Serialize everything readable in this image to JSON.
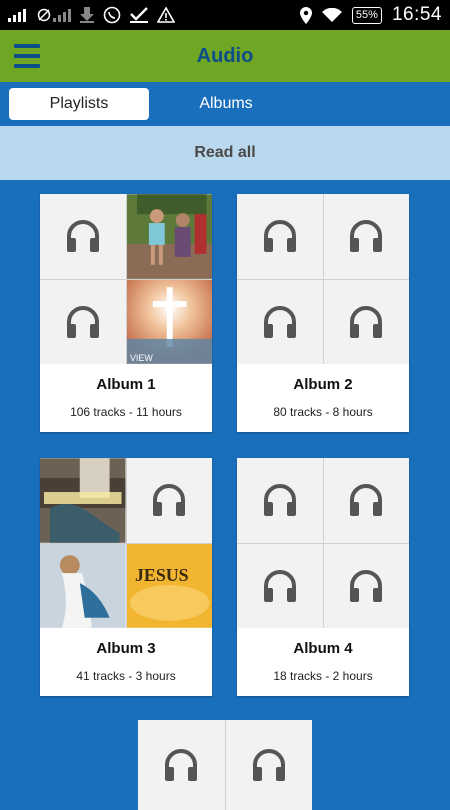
{
  "status_bar": {
    "time": "16:54",
    "battery": "55%"
  },
  "app_bar": {
    "title": "Audio"
  },
  "tabs": [
    {
      "label": "Playlists",
      "active": true
    },
    {
      "label": "Albums",
      "active": false
    }
  ],
  "read_all": "Read all",
  "albums": [
    {
      "title": "Album 1",
      "subtitle": "106 tracks - 11 hours",
      "tiles": [
        "headphones-icon",
        "photo-children",
        "headphones-icon",
        "photo-light-cross"
      ]
    },
    {
      "title": "Album 2",
      "subtitle": "80 tracks - 8 hours",
      "tiles": [
        "headphones-icon",
        "headphones-icon",
        "headphones-icon",
        "headphones-icon"
      ]
    },
    {
      "title": "Album 3",
      "subtitle": "41 tracks - 3 hours",
      "tiles": [
        "photo-telugu-text",
        "headphones-icon",
        "photo-jesus-painting",
        "photo-jesus-text"
      ]
    },
    {
      "title": "Album 4",
      "subtitle": "18 tracks - 2 hours",
      "tiles": [
        "headphones-icon",
        "headphones-icon",
        "headphones-icon",
        "headphones-icon"
      ]
    }
  ],
  "image_text": {
    "album3_jesus": "JESUS",
    "album1_view": "VIEW"
  },
  "colors": {
    "background": "#1a6fbc",
    "app_bar": "#6fa623",
    "title": "#0d4d8a",
    "read_all_bar": "#b9d8ee",
    "icon": "#555555"
  }
}
